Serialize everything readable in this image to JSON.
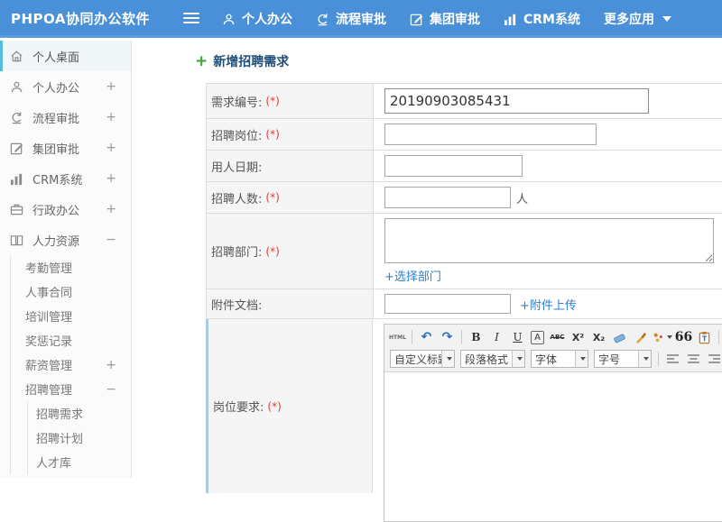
{
  "colors": {
    "topbar_blue": "#4a90d9",
    "link_blue": "#2f7fd1",
    "required_red": "#e03c3c",
    "active_border": "#55bcd9",
    "title_navy": "#1f4e79"
  },
  "topbar": {
    "logo": "PHPOA协同办公软件",
    "nav": [
      {
        "label": "个人办公",
        "icon": "user-icon"
      },
      {
        "label": "流程审批",
        "icon": "process-icon"
      },
      {
        "label": "集团审批",
        "icon": "edit-icon"
      },
      {
        "label": "CRM系统",
        "icon": "chart-icon"
      },
      {
        "label": "更多应用",
        "icon": "caret-down-icon"
      }
    ]
  },
  "sidebar": {
    "items": [
      {
        "label": "个人桌面",
        "icon": "home-icon",
        "active": true,
        "expander": ""
      },
      {
        "label": "个人办公",
        "icon": "user-icon",
        "expander": "+"
      },
      {
        "label": "流程审批",
        "icon": "process-icon",
        "expander": "+"
      },
      {
        "label": "集团审批",
        "icon": "edit-icon",
        "expander": "+"
      },
      {
        "label": "CRM系统",
        "icon": "chart-icon",
        "expander": "+"
      },
      {
        "label": "行政办公",
        "icon": "briefcase-icon",
        "expander": "+"
      },
      {
        "label": "人力资源",
        "icon": "book-icon",
        "expander": "−"
      },
      {
        "label": "考勤管理",
        "expander": ""
      },
      {
        "label": "人事合同",
        "expander": ""
      },
      {
        "label": "培训管理",
        "expander": ""
      },
      {
        "label": "奖惩记录",
        "expander": ""
      },
      {
        "label": "薪资管理",
        "expander": "+"
      },
      {
        "label": "招聘管理",
        "expander": "−"
      },
      {
        "label": "招聘需求",
        "expander": ""
      },
      {
        "label": "招聘计划",
        "expander": ""
      },
      {
        "label": "人才库",
        "expander": ""
      }
    ]
  },
  "main": {
    "title": "新增招聘需求",
    "required_mark": "(*)",
    "form": {
      "demand_no": {
        "label": "需求编号:",
        "value": "20190903085431"
      },
      "position": {
        "label": "招聘岗位:",
        "value": ""
      },
      "hire_date": {
        "label": "用人日期:",
        "value": ""
      },
      "headcount": {
        "label": "招聘人数:",
        "value": "",
        "suffix": "人"
      },
      "department": {
        "label": "招聘部门:",
        "value": "",
        "link": "+选择部门"
      },
      "attachment": {
        "label": "附件文档:",
        "value": "",
        "link": "+附件上传"
      },
      "requirement": {
        "label": "岗位要求:"
      }
    }
  },
  "editor": {
    "html_button": "HTML",
    "bold": "B",
    "italic": "I",
    "underline": "U",
    "font_box": "A",
    "strike": "ABC",
    "superscript": "X²",
    "subscript": "X₂",
    "quote": "66",
    "font_color": "A",
    "cutoff_icon": "a",
    "dropdowns": [
      "自定义标题",
      "段落格式",
      "字体",
      "字号"
    ]
  }
}
